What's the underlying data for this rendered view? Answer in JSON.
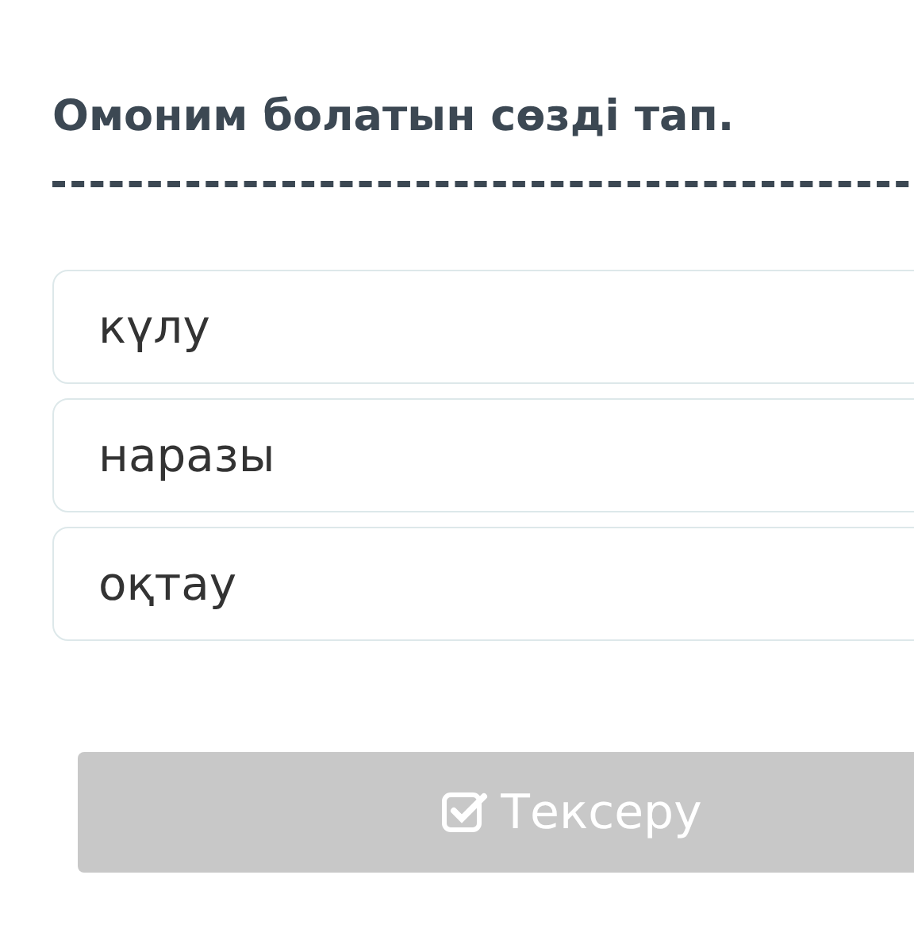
{
  "question": {
    "title": "Омоним болатын сөзді тап."
  },
  "options": [
    {
      "label": "күлу",
      "selected": false
    },
    {
      "label": "наразы",
      "selected": false
    },
    {
      "label": "оқтау",
      "selected": false
    }
  ],
  "check_button": {
    "label": "Тексеру",
    "disabled": true
  }
}
